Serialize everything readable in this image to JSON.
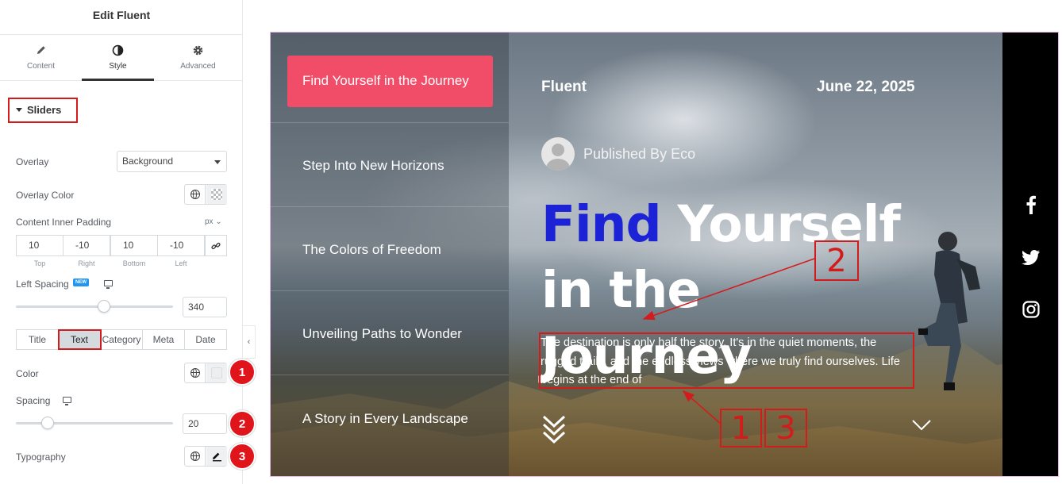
{
  "panel": {
    "title": "Edit Fluent",
    "tabs": [
      {
        "label": "Content",
        "icon": "pencil-icon"
      },
      {
        "label": "Style",
        "icon": "half-circle-icon"
      },
      {
        "label": "Advanced",
        "icon": "gear-icon"
      }
    ],
    "section": "Sliders",
    "overlay": {
      "label": "Overlay",
      "value": "Background"
    },
    "overlay_color": {
      "label": "Overlay Color"
    },
    "padding": {
      "label": "Content Inner Padding",
      "unit": "px",
      "values": [
        "10",
        "-10",
        "10",
        "-10"
      ],
      "sides": [
        "Top",
        "Right",
        "Bottom",
        "Left"
      ]
    },
    "left_spacing": {
      "label": "Left Spacing",
      "badge": "NEW",
      "value": "340",
      "slider_fraction": 0.56
    },
    "segments": [
      "Title",
      "Text",
      "Category",
      "Meta",
      "Date"
    ],
    "active_segment": "Text",
    "color": {
      "label": "Color"
    },
    "spacing": {
      "label": "Spacing",
      "value": "20",
      "slider_fraction": 0.2
    },
    "typography": {
      "label": "Typography"
    },
    "badges": [
      "1",
      "2",
      "3"
    ]
  },
  "preview": {
    "nav": [
      "Find Yourself in the Journey",
      "Step Into New Horizons",
      "The Colors of Freedom",
      "Unveiling Paths to Wonder",
      "A Story in Every Landscape"
    ],
    "brand": "Fluent",
    "date": "June 22, 2025",
    "author": "Published By Eco",
    "headline_highlight": "Find",
    "headline_rest": "Yourself in the Journey",
    "description": "The destination is only half the story. It's in the quiet moments, the rugged trails, and the endless views where we truly find ourselves. Life begins at the end of",
    "social": [
      "facebook-icon",
      "twitter-icon",
      "instagram-icon"
    ],
    "highlight_color": "#1c23d6",
    "active_nav_color": "#f14d68"
  },
  "annotations": {
    "box_a": "2",
    "box_b": "1",
    "box_c": "3"
  }
}
